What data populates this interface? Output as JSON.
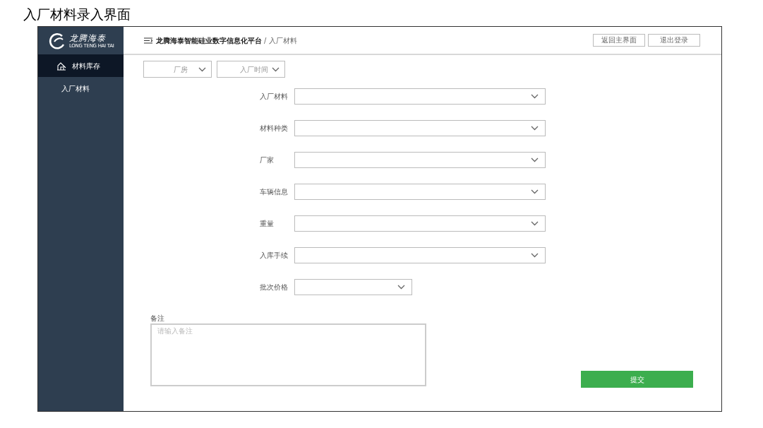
{
  "page_title": "入厂材料录入界面",
  "logo": {
    "name": "龙腾海泰",
    "subtitle": "LONG TENG HAI TAI"
  },
  "sidebar": {
    "items": [
      {
        "label": "材料库存",
        "selected": true,
        "kind": "section"
      },
      {
        "label": "入厂材料",
        "selected": false,
        "kind": "sub"
      }
    ]
  },
  "breadcrumb": {
    "platform": "龙腾海泰智能硅业数字信息化平台",
    "current": "/ 入厂材料"
  },
  "header_buttons": [
    "返回主界面",
    "退出登录"
  ],
  "filters": [
    {
      "label": "厂房"
    },
    {
      "label": "入厂时间"
    }
  ],
  "form_fields": [
    {
      "label": "入厂材料",
      "kind": "wide"
    },
    {
      "label": "材料种类",
      "kind": "wide"
    },
    {
      "label": "厂家",
      "kind": "wide"
    },
    {
      "label": "车辆信息",
      "kind": "wide"
    },
    {
      "label": "重量",
      "kind": "wide"
    },
    {
      "label": "入库手续",
      "kind": "wide"
    },
    {
      "label": "批次价格",
      "kind": "narrow"
    }
  ],
  "remarks": {
    "label": "备注",
    "placeholder": "请输入备注"
  },
  "submit": "提交"
}
